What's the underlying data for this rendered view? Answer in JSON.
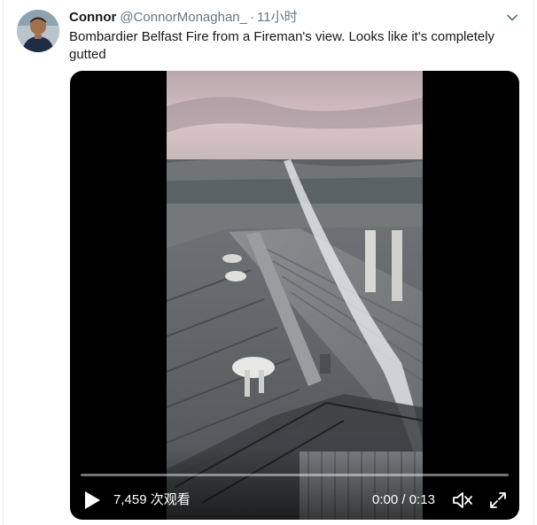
{
  "tweet": {
    "author_name": "Connor",
    "author_handle": "@ConnorMonaghan_",
    "separator": "·",
    "timestamp": "11小时",
    "text": "Bombardier Belfast Fire from a Fireman's view. Looks like it's completely gutted",
    "menu_icon": "chevron-down-icon"
  },
  "video": {
    "views": "7,459 次观看",
    "current_time": "0:00",
    "time_divider": "/",
    "duration": "0:13",
    "progress": 0,
    "icons": {
      "play": "play-icon",
      "volume": "volume-muted-icon",
      "fullscreen": "fullscreen-icon"
    }
  },
  "colors": {
    "text": "#14171a",
    "secondary_text": "#657786",
    "video_bg": "#000000",
    "controls_text": "#ffffff"
  }
}
